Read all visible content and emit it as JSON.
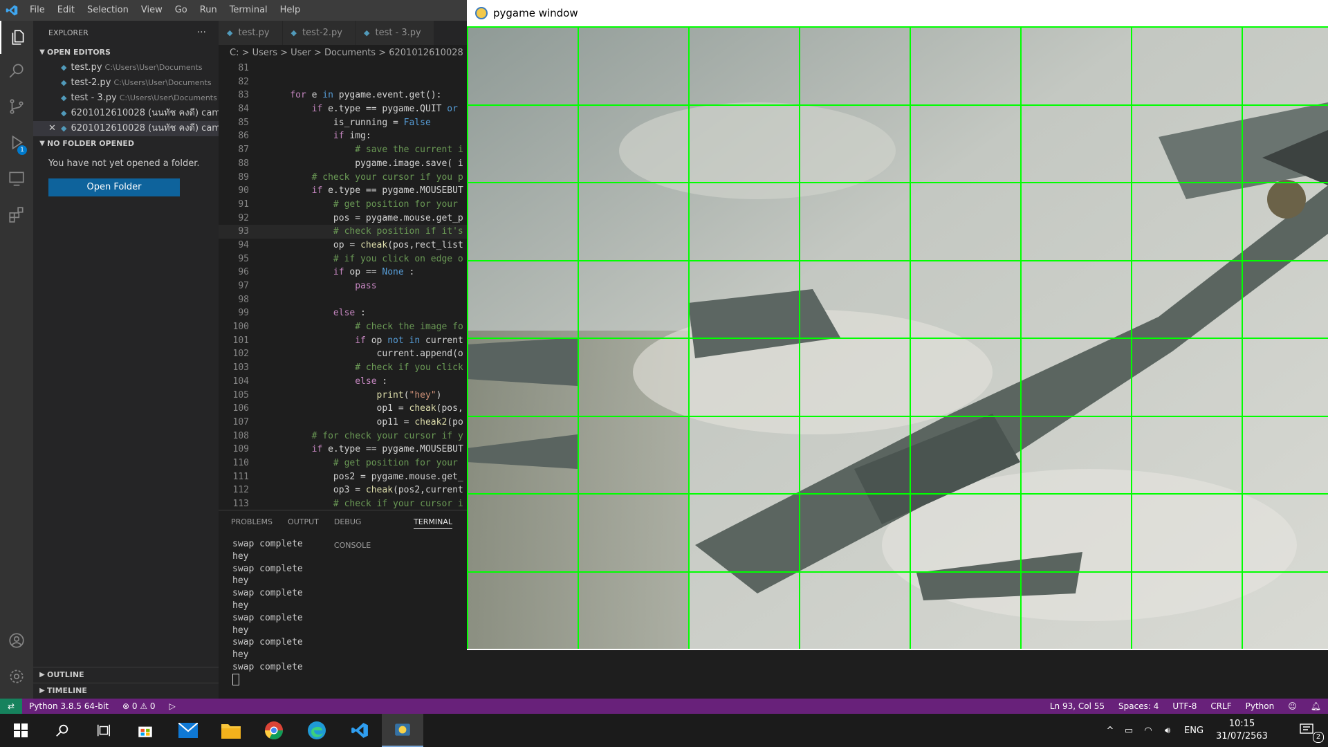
{
  "menu": [
    "File",
    "Edit",
    "Selection",
    "View",
    "Go",
    "Run",
    "Terminal",
    "Help"
  ],
  "sidebar": {
    "title": "EXPLORER",
    "open_editors_title": "OPEN EDITORS",
    "open_editors": [
      {
        "name": "test.py",
        "path": "C:\\Users\\User\\Documents"
      },
      {
        "name": "test-2.py",
        "path": "C:\\Users\\User\\Documents"
      },
      {
        "name": "test - 3.py",
        "path": "C:\\Users\\User\\Documents"
      },
      {
        "name": "6201012610028 (นนทัช คงดี) cam...",
        "path": ""
      },
      {
        "name": "6201012610028 (นนทัช คงดี) cam...",
        "path": ""
      }
    ],
    "no_folder_title": "NO FOLDER OPENED",
    "no_folder_msg": "You have not yet opened a folder.",
    "open_folder_label": "Open Folder",
    "outline_label": "OUTLINE",
    "timeline_label": "TIMELINE",
    "debug_badge": "1"
  },
  "tabs": [
    "test.py",
    "test-2.py",
    "test - 3.py"
  ],
  "breadcrumb": "C: > Users > User > Documents > 6201012610028 (น",
  "code_lines": [
    {
      "n": "81",
      "html": ""
    },
    {
      "n": "82",
      "html": ""
    },
    {
      "n": "83",
      "html": "    <span class='kw'>for</span> e <span class='kw2'>in</span> pygame.event.get():"
    },
    {
      "n": "84",
      "html": "        <span class='kw'>if</span> e.type == pygame.QUIT <span class='kw2'>or</span>"
    },
    {
      "n": "85",
      "html": "            is_running = <span class='kw2'>False</span>"
    },
    {
      "n": "86",
      "html": "            <span class='kw'>if</span> img:"
    },
    {
      "n": "87",
      "html": "                <span class='cm'># save the current i</span>"
    },
    {
      "n": "88",
      "html": "                pygame.image.save( i"
    },
    {
      "n": "89",
      "html": "        <span class='cm'># check your cursor if you p</span>"
    },
    {
      "n": "90",
      "html": "        <span class='kw'>if</span> e.type == pygame.MOUSEBUT"
    },
    {
      "n": "91",
      "html": "            <span class='cm'># get position for your</span>"
    },
    {
      "n": "92",
      "html": "            pos = pygame.mouse.get_p"
    },
    {
      "n": "93",
      "html": "            <span class='cm'># check position if it's</span>"
    },
    {
      "n": "94",
      "html": "            op = <span class='fn'>cheak</span>(pos,rect_list"
    },
    {
      "n": "95",
      "html": "            <span class='cm'># if you click on edge o</span>"
    },
    {
      "n": "96",
      "html": "            <span class='kw'>if</span> op == <span class='kw2'>None</span> :"
    },
    {
      "n": "97",
      "html": "                <span class='kw'>pass</span>"
    },
    {
      "n": "98",
      "html": ""
    },
    {
      "n": "99",
      "html": "            <span class='kw'>else</span> :"
    },
    {
      "n": "100",
      "html": "                <span class='cm'># check the image fo</span>"
    },
    {
      "n": "101",
      "html": "                <span class='kw'>if</span> op <span class='kw2'>not in</span> current"
    },
    {
      "n": "102",
      "html": "                    current.append(o"
    },
    {
      "n": "103",
      "html": "                <span class='cm'># check if you click</span>"
    },
    {
      "n": "104",
      "html": "                <span class='kw'>else</span> :"
    },
    {
      "n": "105",
      "html": "                    <span class='fn'>print</span>(<span class='st'>\"hey\"</span>)"
    },
    {
      "n": "106",
      "html": "                    op1 = <span class='fn'>cheak</span>(pos,"
    },
    {
      "n": "107",
      "html": "                    op11 = <span class='fn'>cheak2</span>(po"
    },
    {
      "n": "108",
      "html": "        <span class='cm'># for check your cursor if y</span>"
    },
    {
      "n": "109",
      "html": "        <span class='kw'>if</span> e.type == pygame.MOUSEBUT"
    },
    {
      "n": "110",
      "html": "            <span class='cm'># get position for your</span>"
    },
    {
      "n": "111",
      "html": "            pos2 = pygame.mouse.get_"
    },
    {
      "n": "112",
      "html": "            op3 = <span class='fn'>cheak</span>(pos2,current"
    },
    {
      "n": "113",
      "html": "            <span class='cm'># check if your cursor i</span>"
    }
  ],
  "panel_tabs": [
    "PROBLEMS",
    "OUTPUT",
    "DEBUG CONSOLE",
    "TERMINAL"
  ],
  "terminal_lines": [
    "swap complete",
    "hey",
    "swap complete",
    "hey",
    "swap complete",
    "hey",
    "swap complete",
    "hey",
    "swap complete",
    "hey",
    "swap complete"
  ],
  "status": {
    "python": "Python 3.8.5 64-bit",
    "problems": "⊗ 0 ⚠ 0",
    "position": "Ln 93, Col 55",
    "spaces": "Spaces: 4",
    "encoding": "UTF-8",
    "eol": "CRLF",
    "language": "Python"
  },
  "pygame": {
    "title": "pygame window",
    "grid_cols": 8,
    "grid_rows": 8,
    "grid_color": "#00ff00"
  },
  "taskbar": {
    "lang": "ENG",
    "time": "10:15",
    "date": "31/07/2563",
    "notification_count": "2"
  },
  "colors": {
    "status_bar": "#68217a",
    "accent": "#0e639c",
    "remote": "#16825d"
  }
}
